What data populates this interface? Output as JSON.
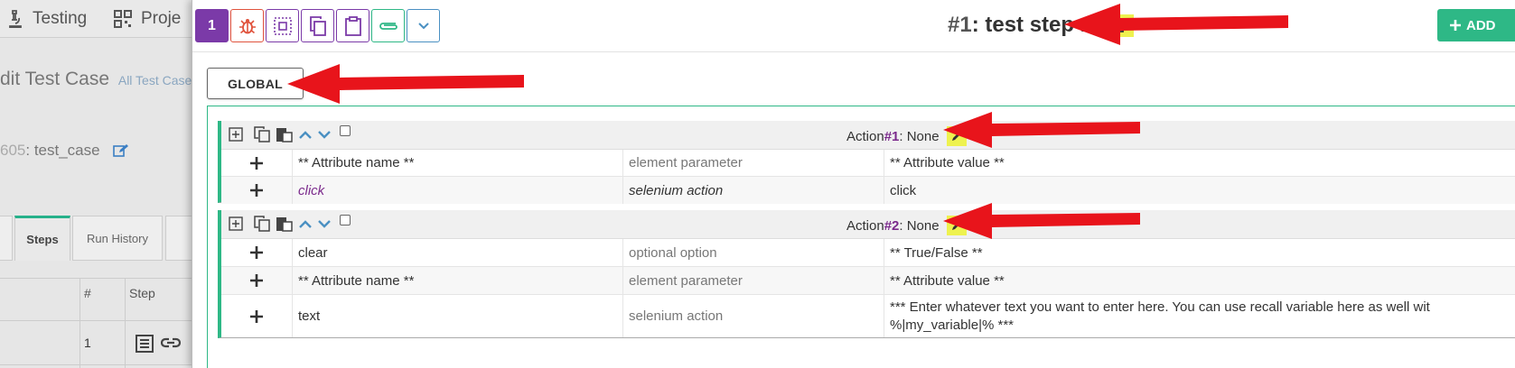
{
  "background_page": {
    "nav": [
      {
        "icon": "microscope-icon",
        "label": "Testing"
      },
      {
        "icon": "qr-code-icon",
        "label": "Proje"
      }
    ],
    "title": "dit Test Case",
    "title_sub": "All Test Cases",
    "case_number": "605",
    "case_name": " : test_case",
    "tabs": [
      "Steps",
      "Run History"
    ],
    "table_headers": [
      "#",
      "Step"
    ],
    "table_row_number": "1"
  },
  "toolbar": {
    "step_number": "1",
    "step_hash": "#1",
    "step_title": " : test step 1",
    "add_label": "ADD",
    "icons": [
      "bug-icon",
      "select-icon",
      "copy-icon",
      "clipboard-icon",
      "attachment-icon",
      "chevron-down-icon"
    ]
  },
  "global_label": "GLOBAL",
  "actions": [
    {
      "label": "Action ",
      "number": "#1",
      "status": ": None",
      "rows": [
        {
          "name": "** Attribute name **",
          "type": "element parameter",
          "value": "** Attribute value **"
        },
        {
          "name": "click",
          "type": "selenium action",
          "value": "click"
        }
      ]
    },
    {
      "label": "Action ",
      "number": "#2",
      "status": ": None",
      "rows": [
        {
          "name": "clear",
          "type": "optional option",
          "value": "** True/False **"
        },
        {
          "name": "** Attribute name **",
          "type": "element parameter",
          "value": "** Attribute value **"
        },
        {
          "name": "text",
          "type": "selenium action",
          "value": "*** Enter whatever text you want to enter here.  You can use recall variable here as well wit",
          "value_line2": "%|my_variable|% ***"
        }
      ]
    }
  ],
  "colors": {
    "accent_purple": "#7b3aa8",
    "accent_green": "#2eb886",
    "highlight_yellow": "#eef24f",
    "arrow_red": "#e8141b"
  }
}
